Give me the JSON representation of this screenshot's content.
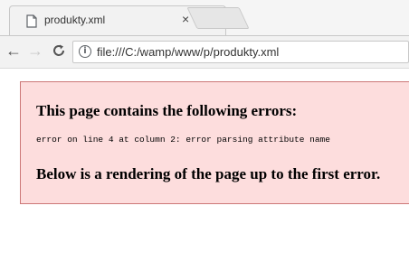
{
  "tab": {
    "title": "produkty.xml",
    "close_glyph": "×",
    "icon": "document-icon"
  },
  "toolbar": {
    "back_glyph": "←",
    "forward_glyph": "→",
    "reload_glyph": "C",
    "url": "file:///C:/wamp/www/p/produkty.xml",
    "info_glyph": "i"
  },
  "error": {
    "title": "This page contains the following errors:",
    "message": "error on line 4 at column 2: error parsing attribute name",
    "footer": "Below is a rendering of the page up to the first error."
  },
  "colors": {
    "error_bg": "#fddddd",
    "error_border": "#cc7777"
  }
}
